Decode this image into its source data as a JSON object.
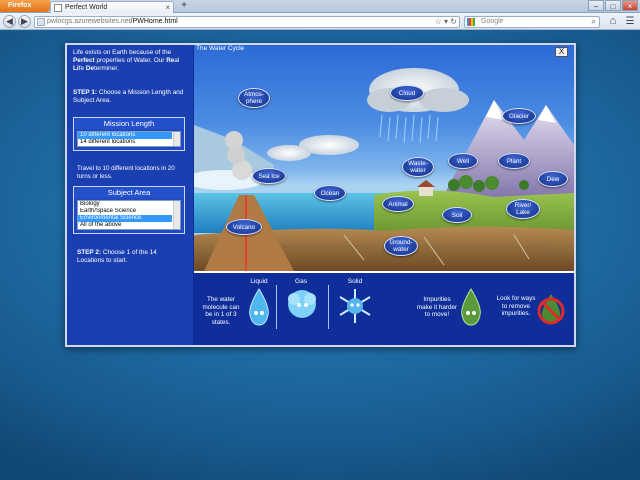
{
  "browser": {
    "firefox_button": "Firefox",
    "tab_title": "Perfect World",
    "url_prefix": "pwlocgs.azurewebsites.net",
    "url_path": "/PWHome.html",
    "search_placeholder": "Google"
  },
  "left_panel": {
    "intro_pre": "Life exists on Earth because of the ",
    "intro_bold1": "Perfect",
    "intro_mid1": " properties of Water. Our ",
    "intro_bold2": "Re",
    "intro_mid2": "al ",
    "intro_bold3": "Li",
    "intro_mid3": "fe ",
    "intro_bold4": "De",
    "intro_end": "terminer.",
    "step1_label": "STEP 1:",
    "step1_text": " Choose a Mission Length and Subject Area.",
    "mission_title": "Mission Length",
    "mission_options": [
      "10 different locations",
      "14 different locations"
    ],
    "mission_desc": "Travel to 10 different locations in 20 turns or less.",
    "subject_title": "Subject Area",
    "subject_options": [
      "Biology",
      "Earth/Space Science",
      "Environmental Science",
      "All of the above"
    ],
    "step2_label": "STEP 2:",
    "step2_text": " Choose 1 of the 14 Locations to start."
  },
  "scene": {
    "title": "The Water Cycle",
    "close": "X",
    "labels": {
      "atmosphere": "Atmos-\nphere",
      "cloud": "Cloud",
      "glacier": "Glacier",
      "sea_ice": "Sea Ice",
      "wastewater": "Waste-\nwater",
      "well": "Well",
      "plant": "Plant",
      "dew": "Dew",
      "ocean": "Ocean",
      "animal": "Animal",
      "river_lake": "River/\nLake",
      "soil": "Soil",
      "volcano": "Volcano",
      "groundwater": "Ground-\nwater"
    }
  },
  "info_strip": {
    "molecule_text": "The water molecule can be in 1 of 3 states.",
    "liquid": "Liquid",
    "gas": "Gas",
    "solid": "Solid",
    "impurities_text": "Impurities make it harder to move!",
    "lookfor_text": "Look for ways to remove impurities."
  },
  "colors": {
    "panel_blue": "#1a3fb0",
    "label_blue": "#1f3f9d",
    "desktop_blue": "#1f6ea8"
  }
}
